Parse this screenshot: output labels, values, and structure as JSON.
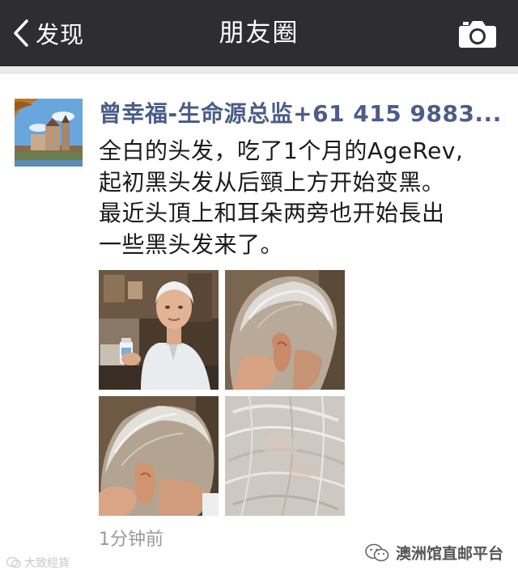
{
  "navbar": {
    "back_label": "发现",
    "title": "朋友圈"
  },
  "post": {
    "username": "曾幸福-生命源总监+61 415 9883...",
    "text_lines": [
      "全白的头发，吃了1个月的AgeRev,",
      "起初黑头发从后頸上方开始变黑。",
      "最近头頂上和耳朵两旁也开始長出",
      "一些黑头发来了。"
    ],
    "timestamp": "1分钟前"
  },
  "watermarks": {
    "left": "大致經貨",
    "right": "澳洲馆直邮平台"
  }
}
